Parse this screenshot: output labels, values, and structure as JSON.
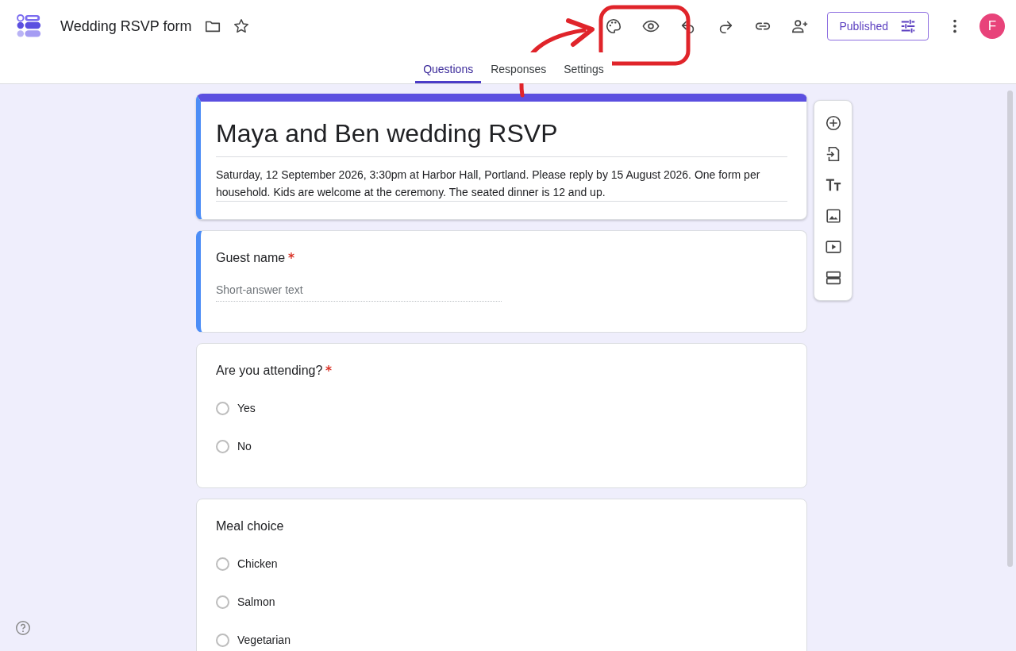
{
  "header": {
    "title": "Wedding RSVP form",
    "publish_button": "Published",
    "avatar": "F"
  },
  "tabs": [
    {
      "label": "Questions",
      "selected": true
    },
    {
      "label": "Responses",
      "selected": false
    },
    {
      "label": "Settings",
      "selected": false
    }
  ],
  "form": {
    "title": "Maya and Ben wedding RSVP",
    "description": "Saturday, 12 September 2026, 3:30pm at Harbor Hall, Portland. Please reply by 15 August 2026. One form per household. Kids are welcome at the ceremony. The seated dinner is 12 and up."
  },
  "questions": [
    {
      "kind": "short",
      "title": "Guest name",
      "required": true,
      "selected": true,
      "placeholder": "Short-answer text"
    },
    {
      "kind": "choice",
      "title": "Are you attending?",
      "required": true,
      "selected": false,
      "options": [
        {
          "label": "Yes",
          "selected": false
        },
        {
          "label": "No",
          "selected": false
        }
      ]
    },
    {
      "kind": "choice",
      "title": "Meal choice",
      "required": false,
      "selected": false,
      "options": [
        {
          "label": "Chicken",
          "selected": false
        },
        {
          "label": "Salmon",
          "selected": false
        },
        {
          "label": "Vegetarian",
          "selected": false
        }
      ]
    }
  ]
}
